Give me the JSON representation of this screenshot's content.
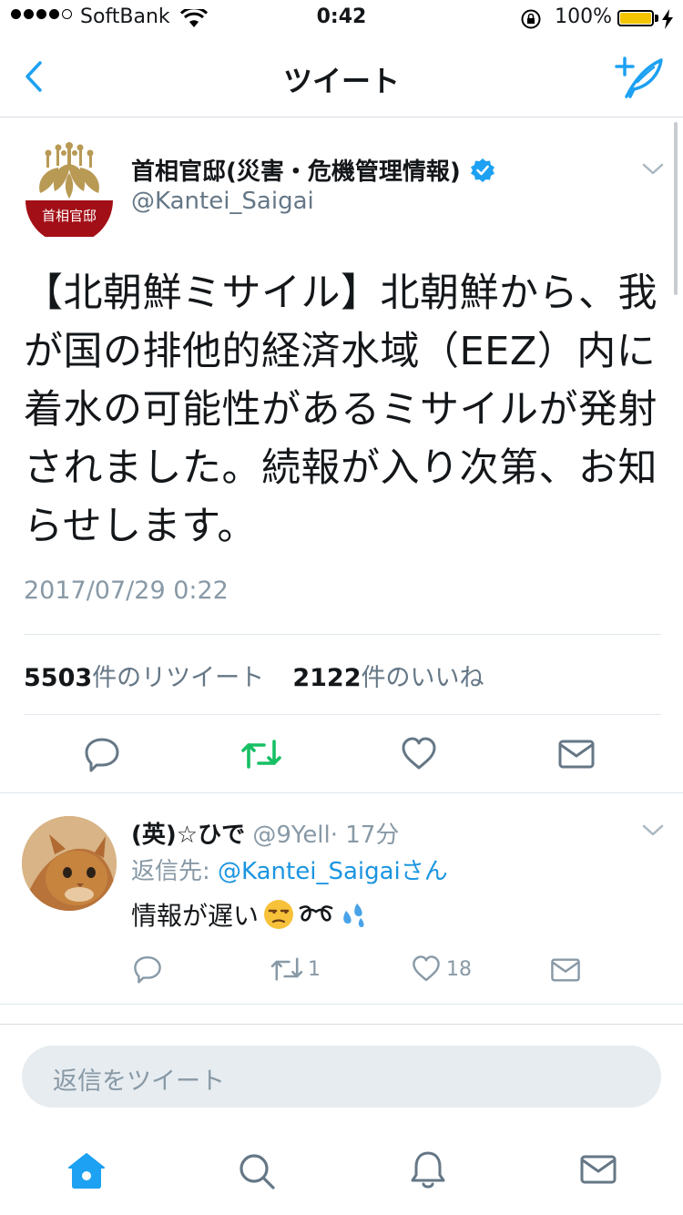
{
  "status_bar": {
    "carrier": "SoftBank",
    "time": "0:42",
    "battery_percent": "100%"
  },
  "nav": {
    "title": "ツイート",
    "back_icon": "chevron-left-icon",
    "compose_icon": "compose-tweet-icon"
  },
  "tweet": {
    "author_name": "首相官邸(災害・危機管理情報)",
    "author_handle": "@Kantei_Saigai",
    "avatar_label": "首相官邸",
    "verified": true,
    "text": "【北朝鮮ミサイル】北朝鮮から、我が国の排他的経済水域（EEZ）内に着水の可能性があるミサイルが発射されました。続報が入り次第、お知らせします。",
    "timestamp": "2017/07/29 0:22",
    "retweet_count": "5503",
    "retweet_label": "件のリツイート",
    "like_count": "2122",
    "like_label": "件のいいね"
  },
  "reply": {
    "author_name": "(英)☆ひで",
    "author_handle": "@9Yell",
    "time_ago": "· 17分",
    "reply_to_prefix": "返信先: ",
    "reply_to_handle": "@Kantei_Saigai",
    "reply_to_suffix": "さん",
    "text": "情報が遅い",
    "retweet_count": "1",
    "like_count": "18"
  },
  "composer": {
    "placeholder": "返信をツイート"
  },
  "colors": {
    "accent": "#1da1f2",
    "retweet_green": "#17bf63",
    "icon_gray": "#657786",
    "avatar_red": "#a30f17",
    "avatar_gold": "#b89a55"
  }
}
